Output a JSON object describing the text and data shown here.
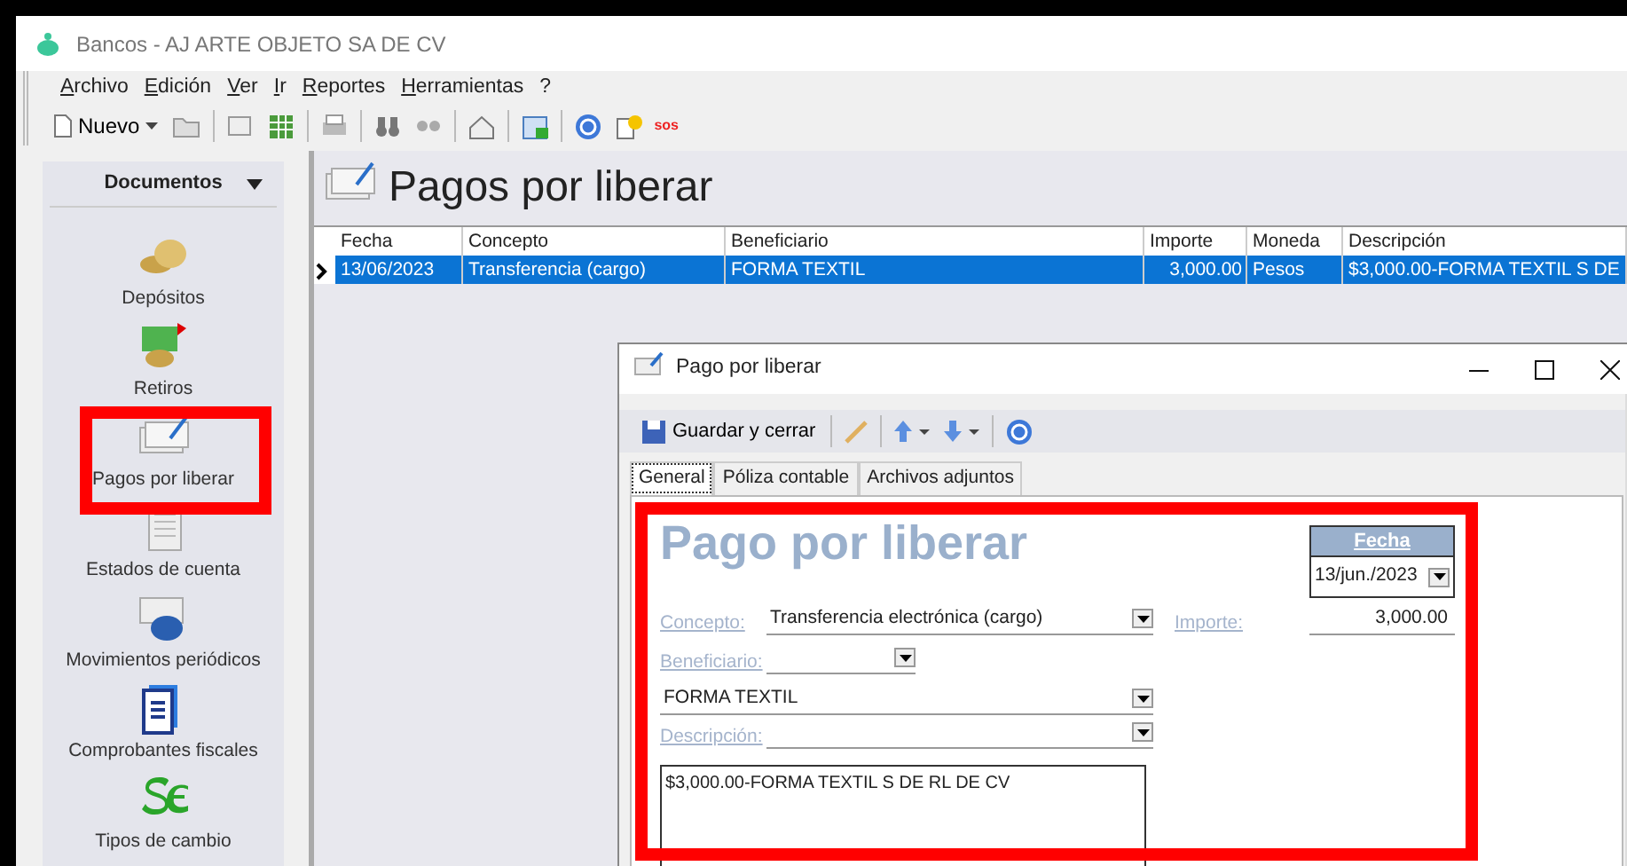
{
  "window": {
    "title": "Bancos - AJ ARTE OBJETO SA DE CV"
  },
  "menu": [
    "Archivo",
    "Edición",
    "Ver",
    "Ir",
    "Reportes",
    "Herramientas",
    "?"
  ],
  "toolbar": {
    "new_label": "Nuevo",
    "sos_label": "sos"
  },
  "sidebar": {
    "title": "Documentos",
    "items": [
      {
        "label": "Depósitos",
        "kind": "coins"
      },
      {
        "label": "Retiros",
        "kind": "withdraw"
      },
      {
        "label": "Pagos por liberar",
        "kind": "cheque"
      },
      {
        "label": "Estados de cuenta",
        "kind": "statement"
      },
      {
        "label": "Movimientos periódicos",
        "kind": "recurring"
      },
      {
        "label": "Comprobantes fiscales",
        "kind": "document"
      },
      {
        "label": "Tipos de cambio",
        "kind": "currency"
      }
    ]
  },
  "main": {
    "title": "Pagos por liberar",
    "table": {
      "columns": [
        "Fecha",
        "Concepto",
        "Beneficiario",
        "Importe",
        "Moneda",
        "Descripción"
      ],
      "rows": [
        {
          "selected": true,
          "cells": [
            "13/06/2023",
            "Transferencia (cargo)",
            "FORMA TEXTIL",
            "3,000.00",
            "Pesos",
            "$3,000.00-FORMA TEXTIL S DE"
          ]
        }
      ]
    }
  },
  "dialog": {
    "title": "Pago por liberar",
    "save_label": "Guardar y cerrar",
    "tabs": [
      {
        "label": "General",
        "selected": true
      },
      {
        "label": "Póliza contable",
        "selected": false
      },
      {
        "label": "Archivos adjuntos",
        "selected": false
      }
    ],
    "form": {
      "heading": "Pago por liberar",
      "date_label": "Fecha",
      "date": "13/jun./2023",
      "concepto_label": "Concepto:",
      "concepto": "Transferencia electrónica (cargo)",
      "importe_label": "Importe:",
      "importe": "3,000.00",
      "beneficiario_label": "Beneficiario:",
      "beneficiario": "FORMA TEXTIL",
      "descripcion_label": "Descripción:",
      "descripcion": "$3,000.00-FORMA TEXTIL S DE RL DE CV"
    }
  }
}
